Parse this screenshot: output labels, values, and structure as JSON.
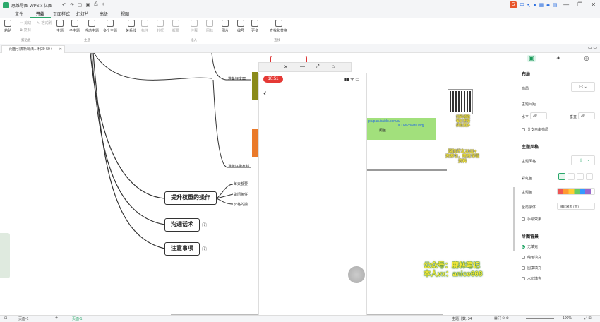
{
  "app": {
    "title": "思维导图-WPS x 亿图"
  },
  "window_controls": {
    "minimize": "—",
    "restore": "❐",
    "close": "✕"
  },
  "ime": {
    "logo": "S",
    "lang": "中"
  },
  "menu": [
    "文件",
    "开始",
    "页面样式",
    "幻灯片",
    "高级",
    "视图"
  ],
  "ribbon": {
    "buttons": [
      "粘贴",
      "剪切",
      "复制",
      "格式刷",
      "主题",
      "子主题",
      "浮动主题",
      "多个主题",
      "关系线",
      "标注",
      "外框",
      "概要",
      "注释",
      "图标",
      "图片",
      "编号",
      "更多",
      "查找和替换"
    ],
    "groups": [
      "剪贴板",
      "主题",
      "插入",
      "查找"
    ]
  },
  "doc_tab": {
    "title": "闲鱼引流新玩法…利30-50+",
    "close": "✕"
  },
  "mindmap": {
    "nodes": [
      "提升权重的操作",
      "沟通话术",
      "注意事项"
    ],
    "sub_labels": [
      "准备好文案",
      "准备好带有斜",
      "每天都要",
      "做闲鱼任",
      "价格的操"
    ],
    "info_icon": "ⓘ"
  },
  "phone": {
    "time": "10:51",
    "back": "‹",
    "window_buttons": [
      "✕",
      "—",
      "⤢",
      "⌂"
    ]
  },
  "link_box": {
    "line1": "pc/pan.baidu.com/s/",
    "line2": "0IUTw?pwd=7sqj",
    "suffix": "闲鱼"
  },
  "overlay": {
    "line1": "公众号：鹿林笔记",
    "line2": "本人vx：anice668"
  },
  "yellow_note": {
    "lines": [
      "扫码领取",
      "每日更新",
      "获取更多"
    ],
    "note2": [
      "添加好友2000+",
      "资源包，赠送课程",
      "资料"
    ]
  },
  "right_panel": {
    "tabs": [
      "▣",
      "✦",
      "◎"
    ],
    "layout": {
      "title": "布局",
      "layout_label": "布局",
      "spacing_label": "主题间距",
      "h_label": "水平",
      "h_value": "30",
      "v_label": "垂直",
      "v_value": "30",
      "crossover": "分支自由布局"
    },
    "style": {
      "title": "主题风格",
      "style_label": "主题风格",
      "rainbow_label": "彩虹色",
      "theme_color_label": "主题色",
      "font_label": "全局字体",
      "font_value": "微软雅黑 (大)",
      "hand_label": "手绘效果"
    },
    "bg": {
      "title": "导图背景",
      "options": [
        "无填充",
        "纯色填充",
        "图案填充",
        "水印填充"
      ]
    }
  },
  "status": {
    "page": "页面-1",
    "add": "+",
    "page_tab": "页面-1",
    "count": "主题计数: 34",
    "zoom": "100%"
  },
  "colors": {
    "brand": "#2aa86b",
    "orange": "#ea7a2a",
    "olive": "#8a8a1a"
  }
}
